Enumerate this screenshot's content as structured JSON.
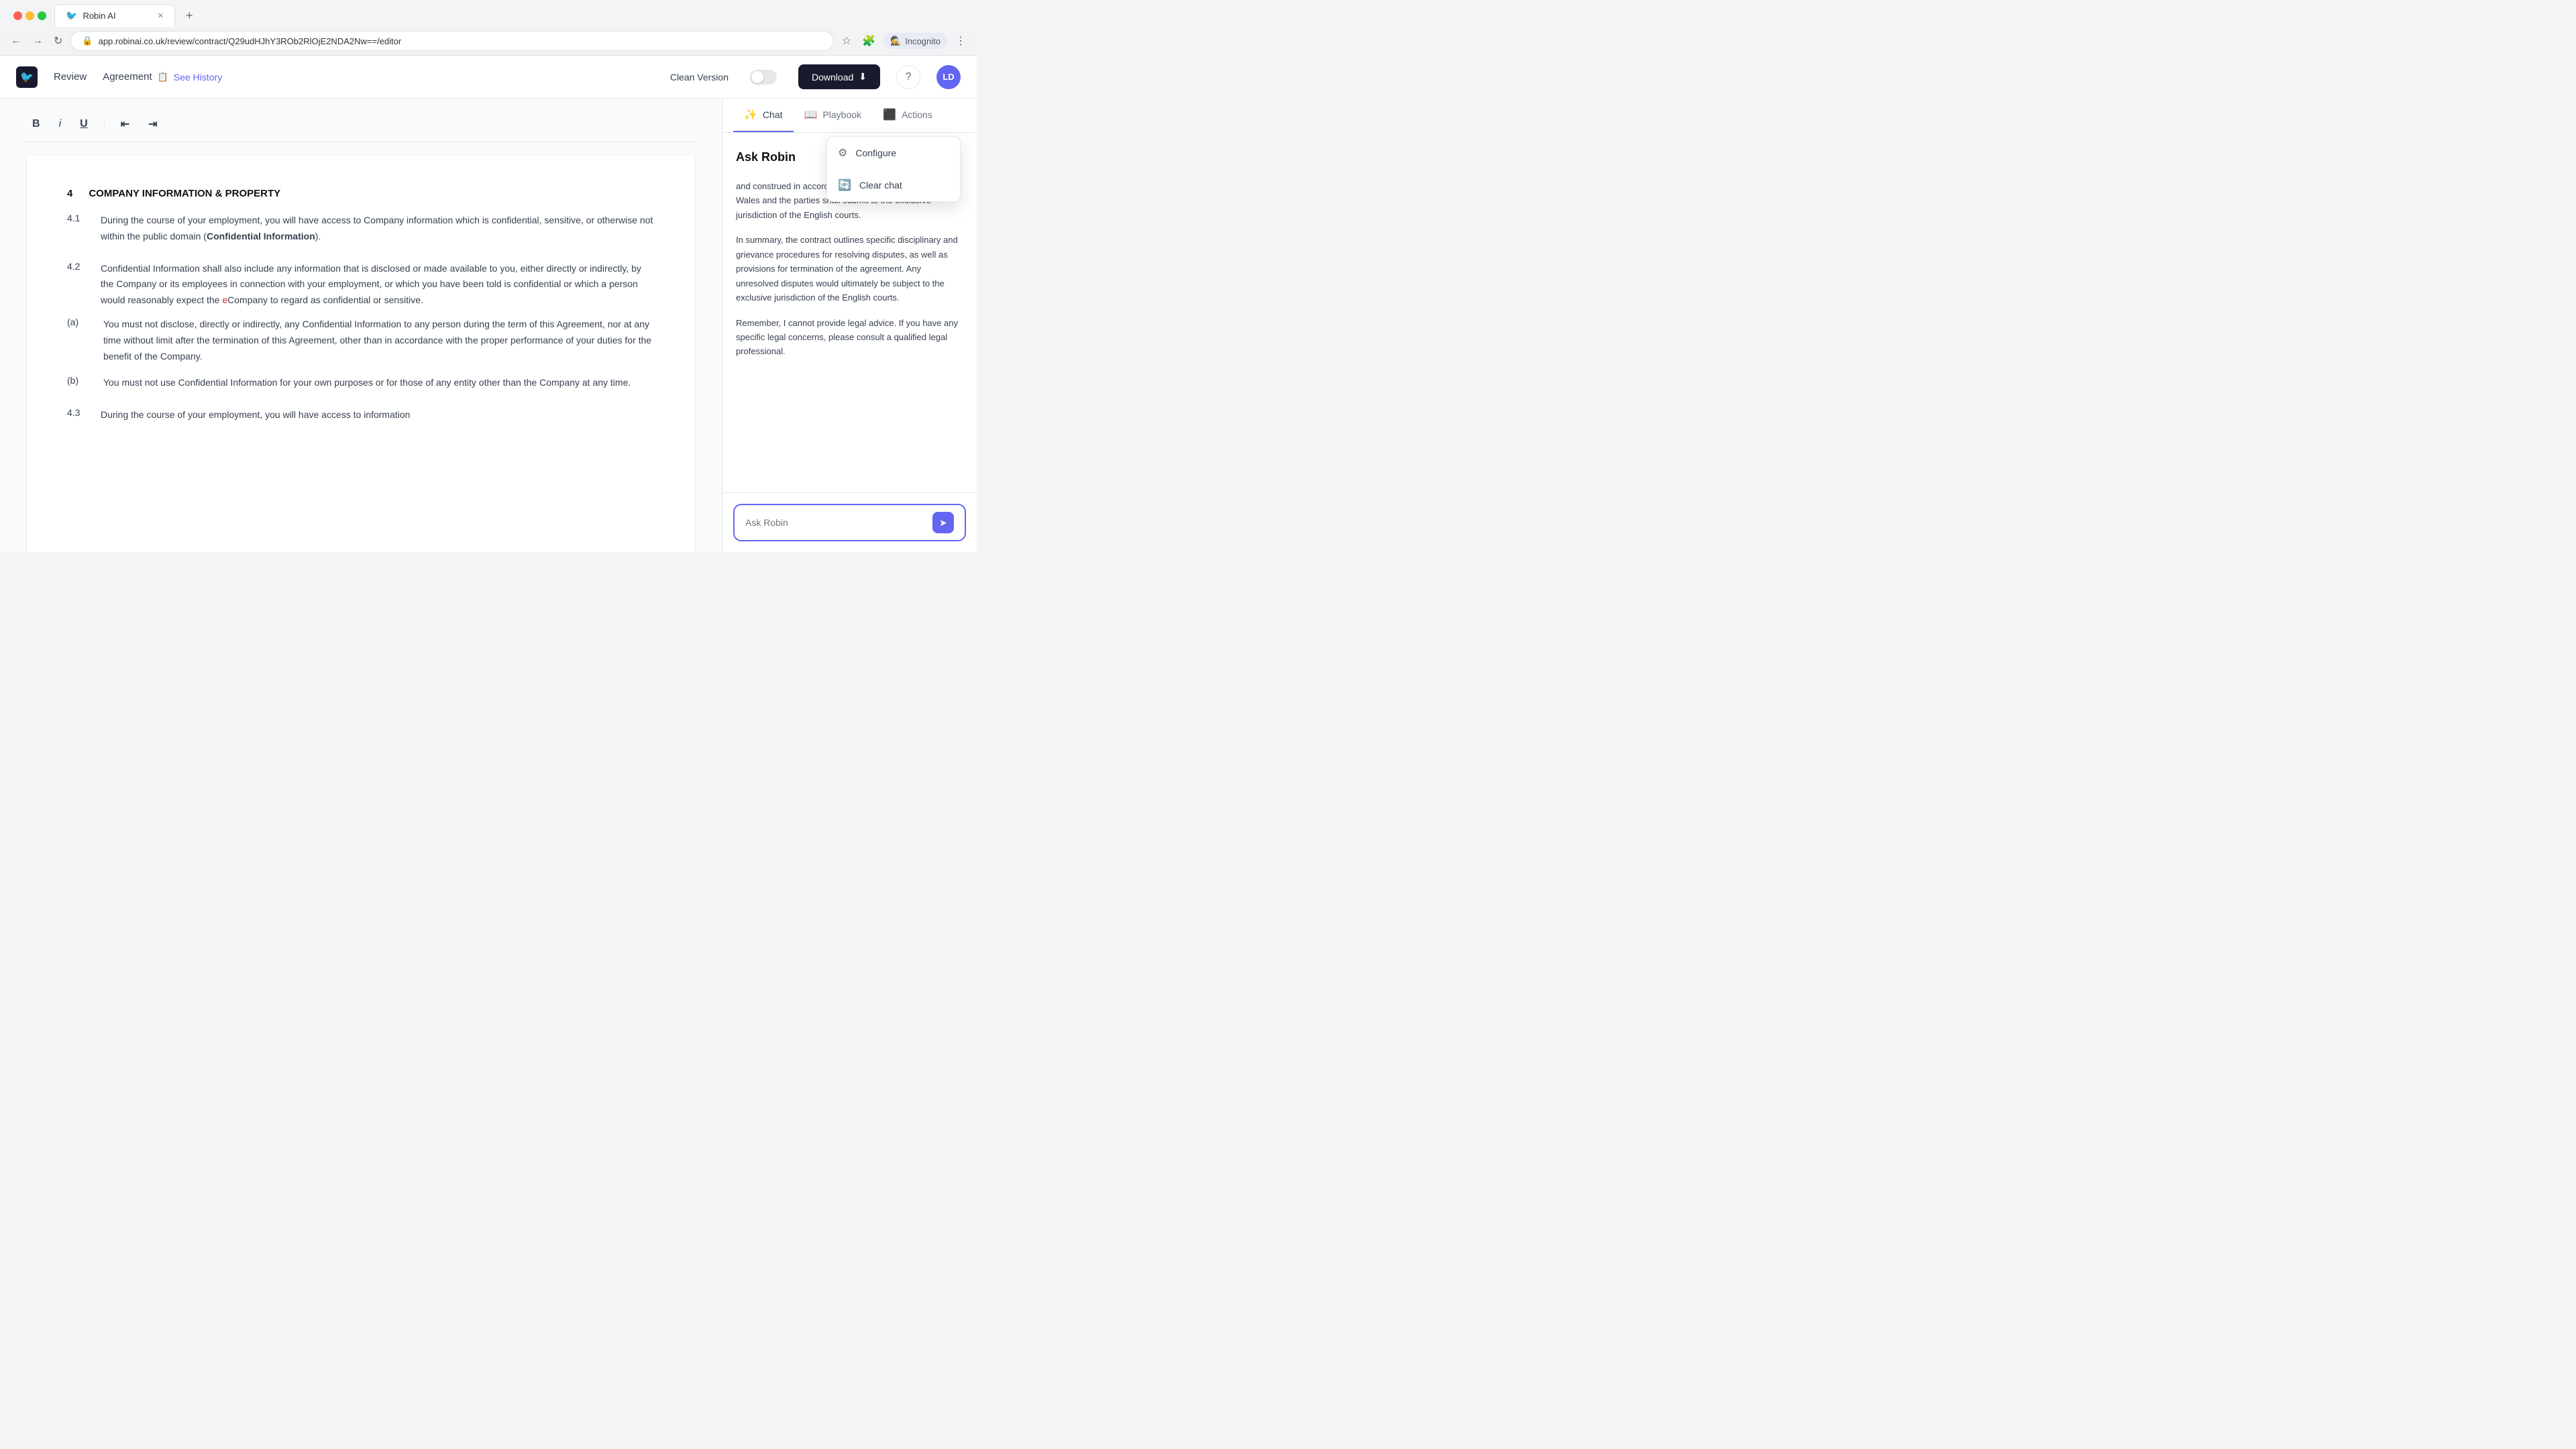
{
  "browser": {
    "tab_title": "Robin AI",
    "tab_icon": "🐦",
    "url": "app.robinai.co.uk/review/contract/Q29udHJhY3ROb2RlOjE2NDA2Nw==/editor",
    "nav_back": "←",
    "nav_forward": "→",
    "nav_refresh": "↻",
    "new_tab": "+",
    "incognito_label": "Incognito"
  },
  "header": {
    "logo_icon": "🐦",
    "review_label": "Review",
    "doc_title": "Agreement",
    "doc_icon": "📋",
    "see_history": "See History",
    "clean_version_label": "Clean Version",
    "download_label": "Download",
    "download_icon": "⬇",
    "help_icon": "?",
    "avatar_label": "LD"
  },
  "toolbar": {
    "bold": "B",
    "italic": "i",
    "underline": "U",
    "indent_left": "⇤",
    "indent_right": "⇥"
  },
  "document": {
    "section_num": "4",
    "section_title": "COMPANY INFORMATION & PROPERTY",
    "subsections": [
      {
        "num": "4.1",
        "text": "During the course of your employment, you will have access to Company information which is confidential, sensitive, or otherwise not within the public domain (",
        "bold_part": "Confidential Information",
        "text_after": ").",
        "sub_items": []
      },
      {
        "num": "4.2",
        "text": "Confidential Information shall also include any information that is disclosed or made available to you, either directly or indirectly, by the Company or its employees in connection with your employment, or which you have been told is confidential or which a person would reasonably expect the ",
        "highlight": "e",
        "text_after2": "Company to regard as confidential or sensitive.",
        "sub_items": [
          {
            "label": "(a)",
            "text": "You must not disclose, directly or indirectly, any Confidential Information to any person during the term of this Agreement, nor at any time without limit after the termination of this Agreement, other than in accordance with the proper performance of your duties for the benefit of the Company."
          },
          {
            "label": "(b)",
            "text": "You must not use Confidential Information for your own purposes or for those of any entity other than the Company at any time."
          }
        ]
      },
      {
        "num": "4.3",
        "text": "During the course of your employment, you will have access to information",
        "sub_items": []
      }
    ]
  },
  "right_panel": {
    "tabs": [
      {
        "label": "Chat",
        "icon": "✨",
        "active": true
      },
      {
        "label": "Playbook",
        "icon": "📖",
        "active": false
      },
      {
        "label": "Actions",
        "icon": "⬜",
        "active": false
      }
    ],
    "chat_title": "Ask Robin",
    "menu_icon": "⋮",
    "messages": [
      {
        "text": "and construed in accordance with the laws of England & Wales and the parties shall submit to the exclusive jurisdiction of the English courts."
      },
      {
        "text": "In summary, the contract outlines specific disciplinary and grievance procedures for resolving disputes, as well as provisions for termination of the agreement. Any unresolved disputes would ultimately be subject to the exclusive jurisdiction of the English courts."
      },
      {
        "text": "Remember, I cannot provide legal advice. If you have any specific legal concerns, please consult a qualified legal professional."
      }
    ],
    "input_placeholder": "Ask Robin",
    "send_icon": "➤",
    "dropdown": {
      "items": [
        {
          "label": "Configure",
          "icon": "⚙"
        },
        {
          "label": "Clear chat",
          "icon": "🔄"
        }
      ]
    }
  }
}
